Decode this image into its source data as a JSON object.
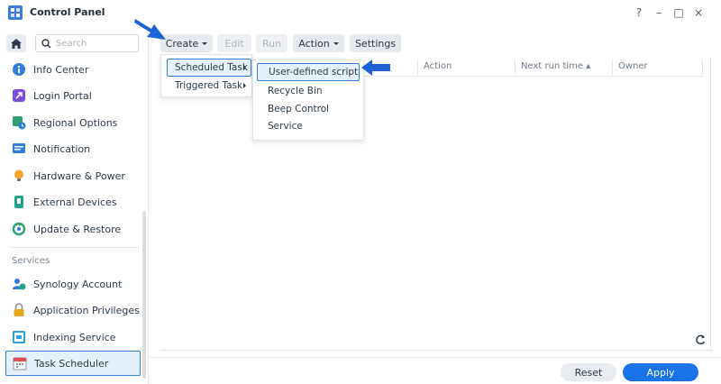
{
  "window": {
    "title": "Control Panel",
    "help": "?",
    "minimize": "–",
    "maximize": "□",
    "close": "×"
  },
  "sidebar": {
    "search_placeholder": "Search",
    "items": [
      {
        "label": "Info Center",
        "icon": "info-icon",
        "color": "#2f7fd8"
      },
      {
        "label": "Login Portal",
        "icon": "login-portal-icon",
        "color": "#7b4fd8"
      },
      {
        "label": "Regional Options",
        "icon": "regional-options-icon",
        "color": "#2ba36b"
      },
      {
        "label": "Notification",
        "icon": "notification-icon",
        "color": "#2f7fd8"
      },
      {
        "label": "Hardware & Power",
        "icon": "lightbulb-icon",
        "color": "#f2a62b"
      },
      {
        "label": "External Devices",
        "icon": "external-devices-icon",
        "color": "#1fa58e"
      },
      {
        "label": "Update & Restore",
        "icon": "update-restore-icon",
        "color": "#2ba36b"
      }
    ],
    "section_title": "Services",
    "service_items": [
      {
        "label": "Synology Account",
        "icon": "synology-account-icon",
        "color": "#2f7fd8"
      },
      {
        "label": "Application Privileges",
        "icon": "lock-icon",
        "color": "#e8a41f"
      },
      {
        "label": "Indexing Service",
        "icon": "indexing-service-icon",
        "color": "#2aa0d8"
      },
      {
        "label": "Task Scheduler",
        "icon": "calendar-icon",
        "color": "#e24b4b"
      }
    ]
  },
  "toolbar": {
    "create": "Create",
    "edit": "Edit",
    "run": "Run",
    "action": "Action",
    "settings": "Settings"
  },
  "grid": {
    "columns": [
      "Action",
      "Next run time",
      "Owner"
    ]
  },
  "create_menu": {
    "items": [
      "Scheduled Task",
      "Triggered Task"
    ]
  },
  "scheduled_submenu": {
    "items": [
      "User-defined script",
      "Recycle Bin",
      "Beep Control",
      "Service"
    ]
  },
  "footer": {
    "reset": "Reset",
    "apply": "Apply"
  },
  "colors": {
    "accent": "#1a73e8",
    "highlight_border": "#2f7fd8",
    "pointer_arrow": "#1e63d6"
  }
}
